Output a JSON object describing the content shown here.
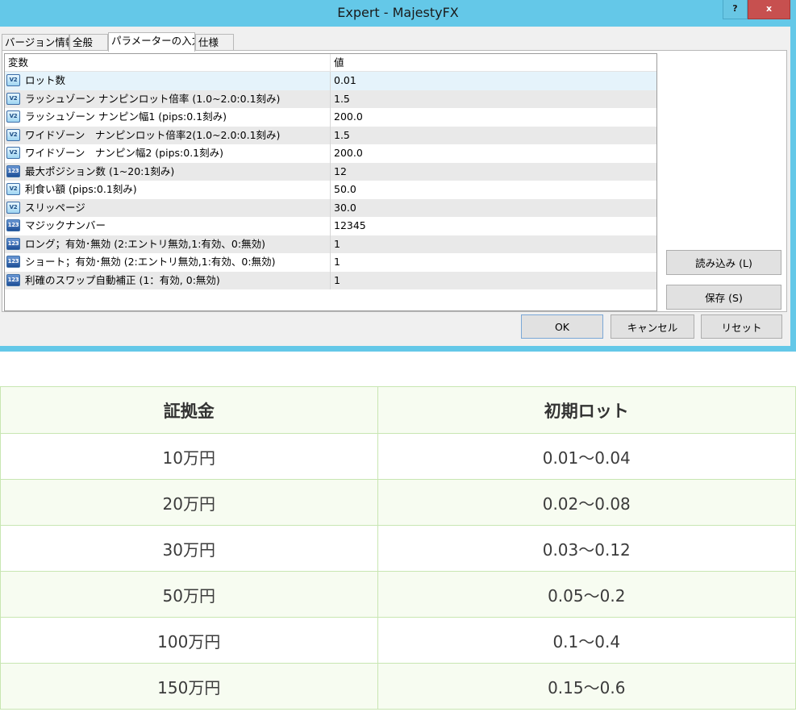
{
  "window": {
    "title": "Expert - MajestyFX",
    "help_label": "?",
    "close_label": "x"
  },
  "tabs": [
    {
      "label": "バージョン情報"
    },
    {
      "label": "全般"
    },
    {
      "label": "パラメーターの入力"
    },
    {
      "label": "仕様"
    }
  ],
  "params": {
    "header": {
      "variable": "変数",
      "value": "値"
    },
    "rows": [
      {
        "icon": "frac",
        "icon_text": "V2",
        "name": "ロット数",
        "value": "0.01"
      },
      {
        "icon": "frac",
        "icon_text": "V2",
        "name": "ラッシュゾーン ナンピンロット倍率 (1.0~2.0:0.1刻み)",
        "value": "1.5"
      },
      {
        "icon": "frac",
        "icon_text": "V2",
        "name": "ラッシュゾーン ナンピン幅1 (pips:0.1刻み)",
        "value": "200.0"
      },
      {
        "icon": "frac",
        "icon_text": "V2",
        "name": "ワイドゾーン　ナンピンロット倍率2(1.0~2.0:0.1刻み)",
        "value": "1.5"
      },
      {
        "icon": "frac",
        "icon_text": "V2",
        "name": "ワイドゾーン　ナンピン幅2 (pips:0.1刻み)",
        "value": "200.0"
      },
      {
        "icon": "int",
        "icon_text": "123",
        "name": "最大ポジション数 (1~20:1刻み)",
        "value": "12"
      },
      {
        "icon": "frac",
        "icon_text": "V2",
        "name": "利食い額 (pips:0.1刻み)",
        "value": "50.0"
      },
      {
        "icon": "frac",
        "icon_text": "V2",
        "name": "スリッページ",
        "value": "30.0"
      },
      {
        "icon": "int",
        "icon_text": "123",
        "name": "マジックナンバー",
        "value": "12345"
      },
      {
        "icon": "int",
        "icon_text": "123",
        "name": "ロング；有効･無効 (2:エントリ無効,1:有効、0:無効)",
        "value": "1"
      },
      {
        "icon": "int",
        "icon_text": "123",
        "name": "ショート；有効･無効 (2:エントリ無効,1:有効、0:無効)",
        "value": "1"
      },
      {
        "icon": "int",
        "icon_text": "123",
        "name": "利確のスワップ自動補正 (1：有効, 0:無効)",
        "value": "1"
      }
    ]
  },
  "buttons": {
    "load": "読み込み (L)",
    "save": "保存 (S)",
    "ok": "OK",
    "cancel": "キャンセル",
    "reset": "リセット"
  },
  "lot_table": {
    "headers": [
      "証拠金",
      "初期ロット"
    ],
    "rows": [
      [
        "10万円",
        "0.01〜0.04"
      ],
      [
        "20万円",
        "0.02〜0.08"
      ],
      [
        "30万円",
        "0.03〜0.12"
      ],
      [
        "50万円",
        "0.05〜0.2"
      ],
      [
        "100万円",
        "0.1〜0.4"
      ],
      [
        "150万円",
        "0.15〜0.6"
      ]
    ]
  }
}
